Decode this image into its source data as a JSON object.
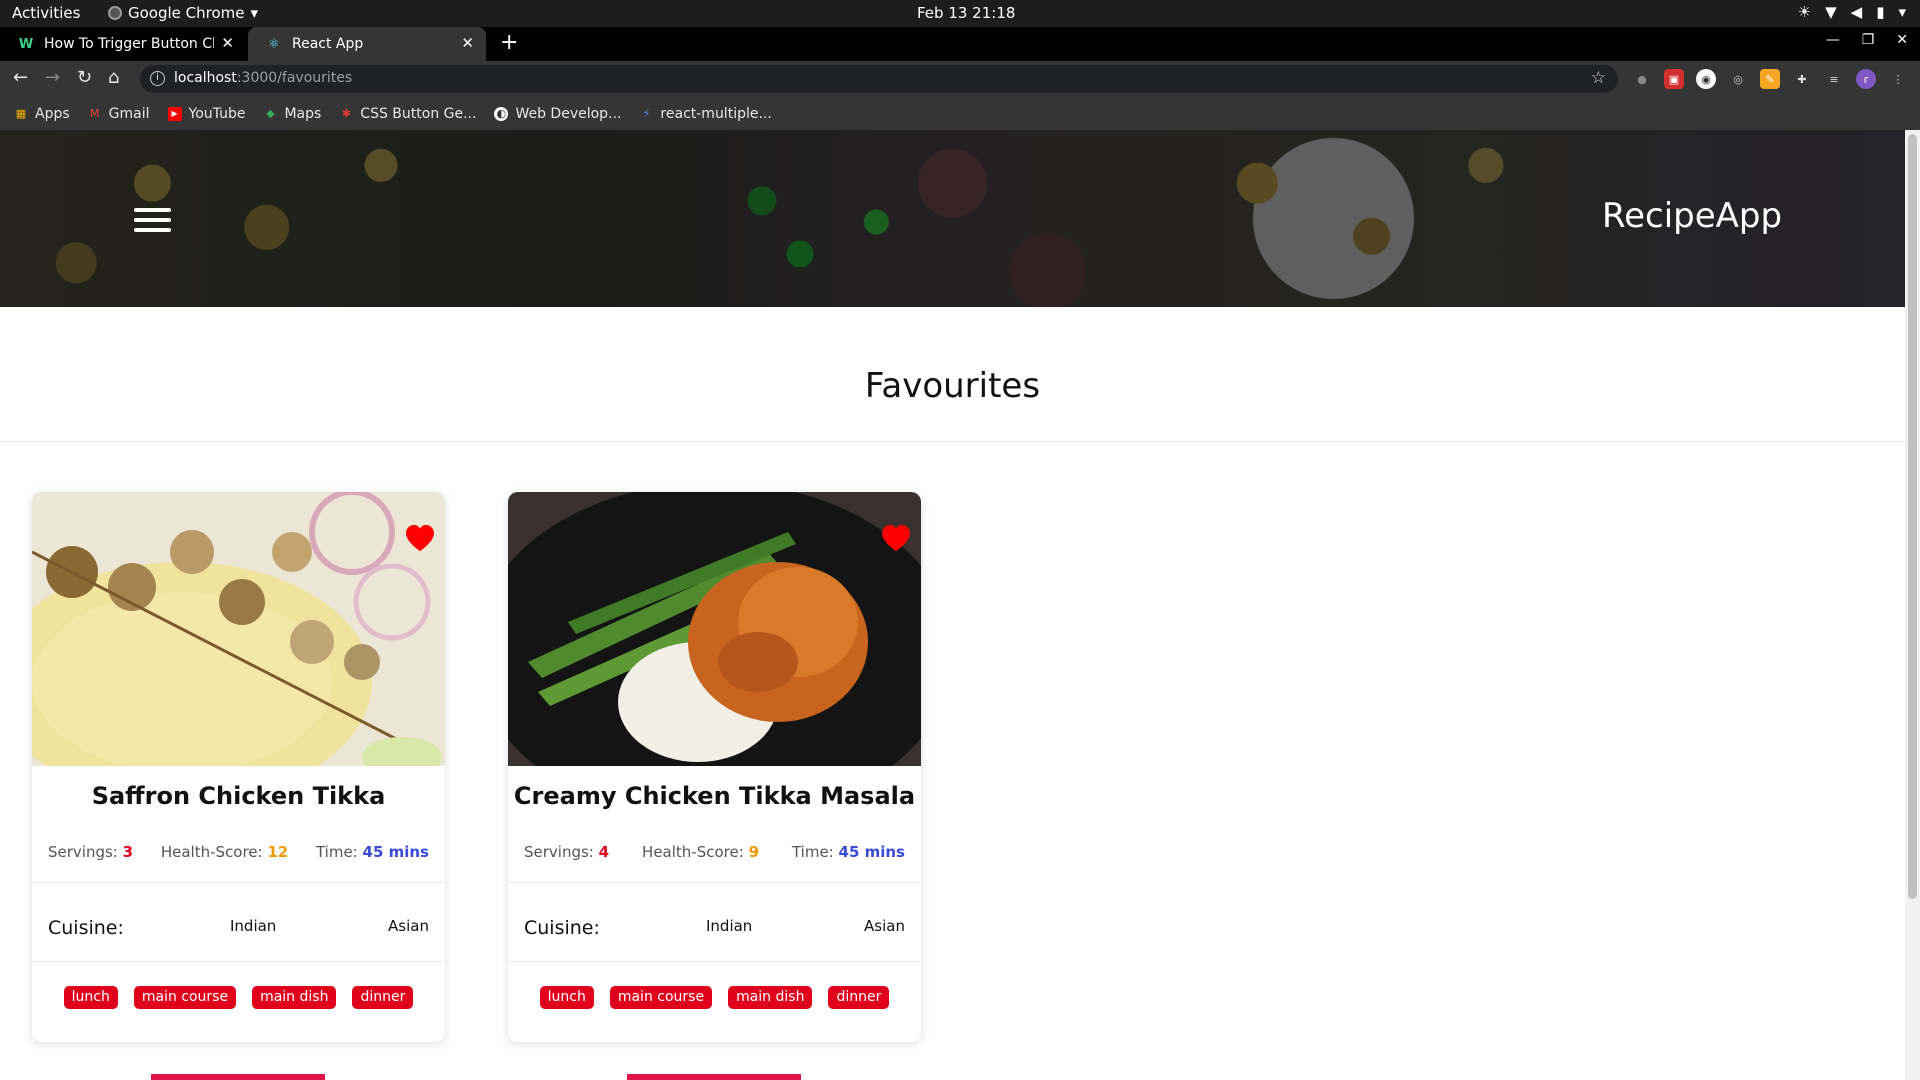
{
  "system_bar": {
    "activities": "Activities",
    "app_name": "Google Chrome",
    "clock": "Feb 13  21:18"
  },
  "browser": {
    "tabs": [
      {
        "title": "How To Trigger Button Cl",
        "active": false
      },
      {
        "title": "React App",
        "active": true
      }
    ],
    "url_host": "localhost",
    "url_path": ":3000/favourites",
    "bookmarks": [
      {
        "label": "Apps",
        "icon": "apps-grid-icon"
      },
      {
        "label": "Gmail",
        "icon": "gmail-icon"
      },
      {
        "label": "YouTube",
        "icon": "youtube-icon"
      },
      {
        "label": "Maps",
        "icon": "maps-icon"
      },
      {
        "label": "CSS Button Ge...",
        "icon": "css-button-icon"
      },
      {
        "label": "Web Develop...",
        "icon": "web-dev-icon"
      },
      {
        "label": "react-multiple...",
        "icon": "lightning-icon"
      }
    ]
  },
  "header": {
    "brand": "RecipeApp"
  },
  "main": {
    "title": "Favourites",
    "cards": [
      {
        "title": "Saffron Chicken Tikka",
        "servings_label": "Servings:",
        "servings": "3",
        "health_label": "Health-Score:",
        "health": "12",
        "time_label": "Time:",
        "time": "45 mins",
        "cuisine_label": "Cuisine:",
        "cuisines": [
          "Indian",
          "Asian"
        ],
        "tags": [
          "lunch",
          "main course",
          "main dish",
          "dinner"
        ],
        "favourited": true
      },
      {
        "title": "Creamy Chicken Tikka Masala",
        "servings_label": "Servings:",
        "servings": "4",
        "health_label": "Health-Score:",
        "health": "9",
        "time_label": "Time:",
        "time": "45 mins",
        "cuisine_label": "Cuisine:",
        "cuisines": [
          "Indian",
          "Asian"
        ],
        "tags": [
          "lunch",
          "main course",
          "main dish",
          "dinner"
        ],
        "favourited": true
      }
    ]
  },
  "colors": {
    "accent_red": "#e0001b",
    "health_orange": "#f09a00",
    "time_blue": "#3a4bd6"
  }
}
